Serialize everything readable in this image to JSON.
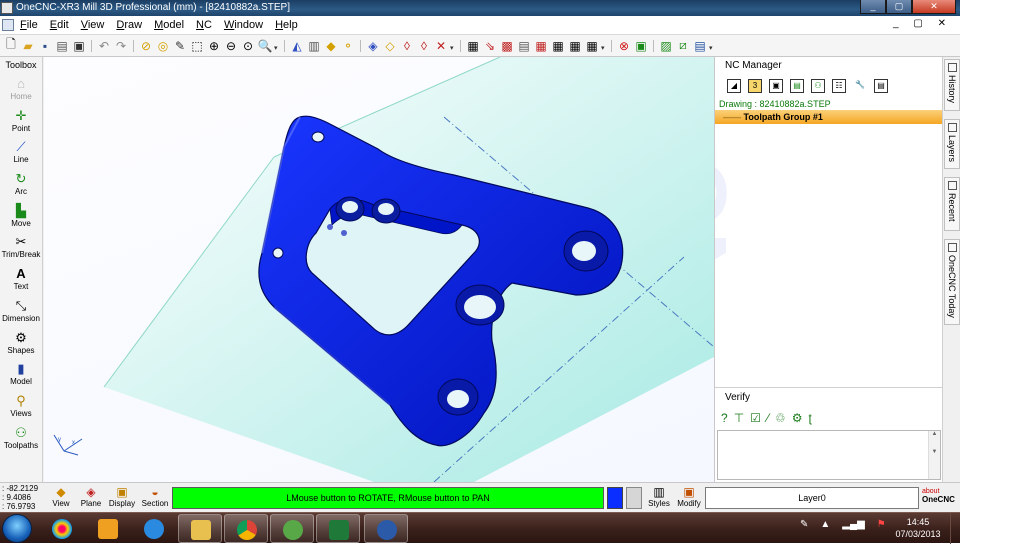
{
  "window": {
    "title": "OneCNC-XR3 Mill 3D Professional (mm) - [82410882a.STEP]",
    "controls": [
      "_",
      "▢",
      "✕"
    ]
  },
  "menu": {
    "items": [
      "File",
      "Edit",
      "View",
      "Draw",
      "Model",
      "NC",
      "Window",
      "Help"
    ],
    "mdi_controls": "_ ▢ ✕"
  },
  "toolbox": {
    "title": "Toolbox",
    "items": [
      {
        "label": "Home",
        "icon": "home-icon",
        "enabled": false
      },
      {
        "label": "Point",
        "icon": "point-icon",
        "enabled": true
      },
      {
        "label": "Line",
        "icon": "line-icon",
        "enabled": true
      },
      {
        "label": "Arc",
        "icon": "arc-icon",
        "enabled": true
      },
      {
        "label": "Move",
        "icon": "move-icon",
        "enabled": true
      },
      {
        "label": "Trim/Break",
        "icon": "scissors-icon",
        "enabled": true
      },
      {
        "label": "Text",
        "icon": "text-icon",
        "enabled": true
      },
      {
        "label": "Dimension",
        "icon": "dimension-icon",
        "enabled": true
      },
      {
        "label": "Shapes",
        "icon": "shapes-icon",
        "enabled": true
      },
      {
        "label": "Model",
        "icon": "model-icon",
        "enabled": true
      },
      {
        "label": "Views",
        "icon": "magnifier-icon",
        "enabled": true
      },
      {
        "label": "Toolpaths",
        "icon": "toolpaths-icon",
        "enabled": true
      }
    ]
  },
  "nc_manager": {
    "title": "NC Manager",
    "drawing": "Drawing : 82410882a.STEP",
    "group": "Toolpath Group #1",
    "splitter": "....."
  },
  "verify": {
    "title": "Verify"
  },
  "side_tabs": [
    "History",
    "Layers",
    "Recent",
    "OneCNC Today"
  ],
  "status": {
    "coords": [
      ": -82.2129",
      ": 9.4086",
      ": 76.9793"
    ],
    "buttons": [
      "View",
      "Plane",
      "Display",
      "Section"
    ],
    "message": "LMouse button to ROTATE, RMouse button to PAN",
    "right_buttons": [
      "Styles",
      "Modify"
    ],
    "layer": "Layer0",
    "about_line1": "about",
    "about_line2": "OneCNC"
  },
  "taskbar": {
    "time": "14:45",
    "date": "07/03/2013"
  },
  "colors": {
    "part": "#0019d8",
    "status_green": "#00ff00",
    "group_highlight": "#f5a623",
    "drawing_text": "#0a7a0a"
  }
}
